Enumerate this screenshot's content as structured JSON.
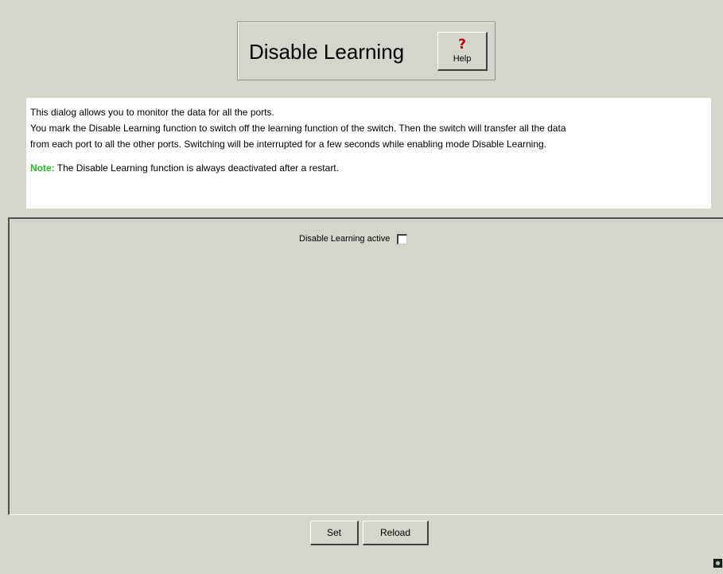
{
  "header": {
    "title": "Disable Learning",
    "help_label": "Help",
    "help_icon": "?"
  },
  "info": {
    "lines": [
      "This dialog allows you to monitor the data for all the ports.",
      "You mark the Disable Learning function to switch off the learning function of the switch. Then the switch will transfer all the data",
      "from each port to all the other ports. Switching will be interrupted for a few seconds while enabling mode Disable Learning."
    ],
    "note_label": "Note:",
    "note_text": " The Disable Learning function is always deactivated after a restart."
  },
  "form": {
    "disable_learning_label": "Disable Learning active",
    "disable_learning_checked": false
  },
  "buttons": {
    "set_label": "Set",
    "reload_label": "Reload"
  },
  "colors": {
    "background": "#d4d6cc",
    "note": "#22bb22",
    "help_icon": "#c00000"
  }
}
